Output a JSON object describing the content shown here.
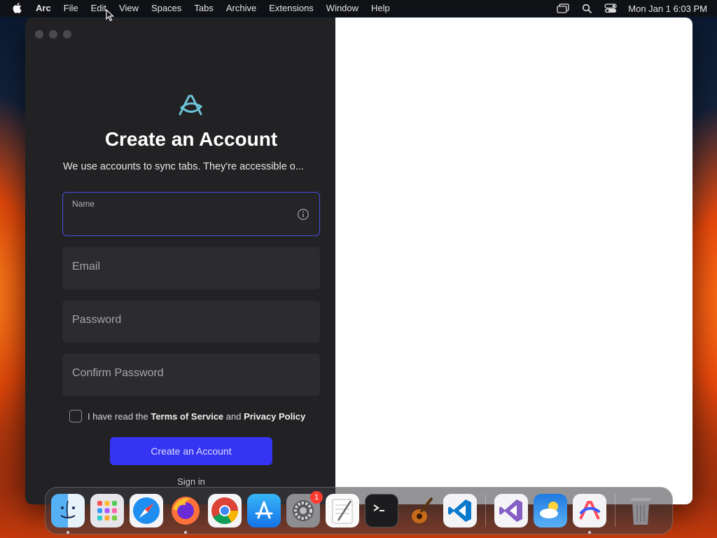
{
  "menubar": {
    "app_name": "Arc",
    "items": [
      "File",
      "Edit",
      "View",
      "Spaces",
      "Tabs",
      "Archive",
      "Extensions",
      "Window",
      "Help"
    ],
    "clock": "Mon Jan 1  6:03 PM",
    "icons": [
      "apple-icon",
      "screen-mirror-icon",
      "spotlight-search-icon",
      "control-center-icon"
    ]
  },
  "signup": {
    "heading": "Create an Account",
    "subtext": "We use accounts to sync tabs. They're accessible o...",
    "name_label": "Name",
    "email_placeholder": "Email",
    "password_placeholder": "Password",
    "confirm_placeholder": "Confirm Password",
    "terms_prefix": "I have read the ",
    "terms_link": "Terms of Service",
    "terms_and": " and ",
    "privacy_link": "Privacy Policy",
    "create_button": "Create an Account",
    "signin_link": "Sign in"
  },
  "dock": {
    "apps": [
      "Finder",
      "Launchpad",
      "Safari",
      "Firefox",
      "Chrome",
      "App Store",
      "System Settings",
      "TextEdit",
      "Terminal",
      "GarageBand",
      "VS Code",
      "Visual Studio",
      "Weather",
      "Arc",
      "Trash"
    ],
    "settings_badge": "1"
  },
  "colors": {
    "accent": "#3434f2",
    "focus_border": "#4a4ce0",
    "sidebar_bg": "#222224",
    "field_bg": "#2c2c2e"
  }
}
